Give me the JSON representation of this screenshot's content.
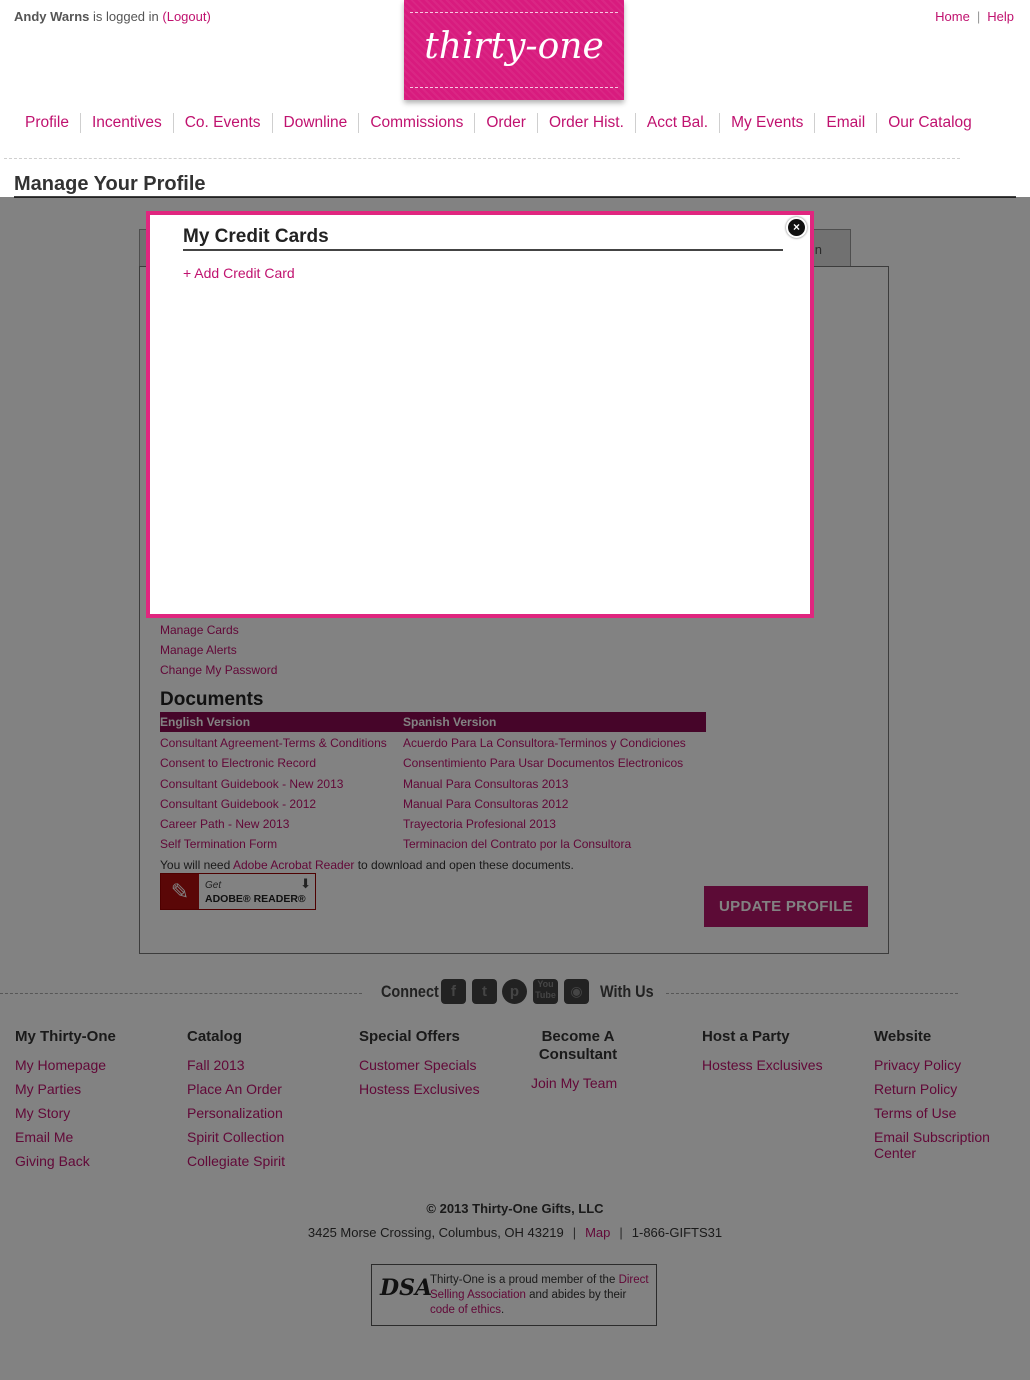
{
  "header": {
    "user_name": "Andy Warns",
    "logged_in_text": "is logged in",
    "logout_label": "(Logout)",
    "home_label": "Home",
    "help_label": "Help",
    "logo_text": "thirty-one"
  },
  "nav": [
    {
      "label": "Profile"
    },
    {
      "label": "Incentives"
    },
    {
      "label": "Co. Events"
    },
    {
      "label": "Downline"
    },
    {
      "label": "Commissions"
    },
    {
      "label": "Order"
    },
    {
      "label": "Order Hist."
    },
    {
      "label": "Acct Bal."
    },
    {
      "label": "My Events"
    },
    {
      "label": "Email"
    },
    {
      "label": "Our Catalog"
    }
  ],
  "page_title": "Manage Your Profile",
  "background_tab_fragment": "n",
  "account_links": [
    {
      "label": "Manage Cards"
    },
    {
      "label": "Manage Alerts"
    },
    {
      "label": "Change My Password"
    }
  ],
  "documents": {
    "title": "Documents",
    "english_header": "English Version",
    "spanish_header": "Spanish Version",
    "english": [
      {
        "label": "Consultant Agreement-Terms & Conditions"
      },
      {
        "label": "Consent to Electronic Record"
      },
      {
        "label": "Consultant Guidebook - New 2013"
      },
      {
        "label": "Consultant Guidebook - 2012"
      },
      {
        "label": "Career Path - New 2013"
      },
      {
        "label": "Self Termination Form"
      }
    ],
    "spanish": [
      {
        "label": "Acuerdo Para La Consultora-Terminos y Condiciones"
      },
      {
        "label": "Consentimiento Para Usar Documentos Electronicos"
      },
      {
        "label": "Manual Para Consultoras 2013"
      },
      {
        "label": "Manual Para Consultoras 2012"
      },
      {
        "label": "Trayectoria Profesional 2013"
      },
      {
        "label": "Terminacion del Contrato por la Consultora"
      }
    ],
    "acrobat_note_pre": "You will need",
    "acrobat_link": "Adobe Acrobat Reader",
    "acrobat_note_post": "to download and open these documents.",
    "reader_get": "Get",
    "reader_name": "ADOBE® READER®"
  },
  "update_button": "UPDATE PROFILE",
  "connect": {
    "connect_label": "Connect",
    "with_us_label": "With Us",
    "icons": [
      "facebook-icon",
      "twitter-icon",
      "pinterest-icon",
      "youtube-icon",
      "instagram-icon"
    ]
  },
  "footer_columns": [
    {
      "title": "My Thirty-One",
      "links": [
        "My Homepage",
        "My Parties",
        "My Story",
        "Email Me",
        "Giving Back"
      ]
    },
    {
      "title": "Catalog",
      "links": [
        "Fall 2013",
        "Place An Order",
        "Personalization",
        "Spirit Collection",
        "Collegiate Spirit"
      ]
    },
    {
      "title": "Special Offers",
      "links": [
        "Customer Specials",
        "Hostess Exclusives"
      ]
    },
    {
      "title": "Become A Consultant",
      "links": [
        "Join My Team"
      ]
    },
    {
      "title": "Host a Party",
      "links": [
        "Hostess Exclusives"
      ]
    },
    {
      "title": "Website",
      "links": [
        "Privacy Policy",
        "Return Policy",
        "Terms of Use",
        "Email Subscription Center"
      ]
    }
  ],
  "copyright": "© 2013 Thirty-One Gifts, LLC",
  "address": "3425 Morse Crossing, Columbus, OH 43219",
  "map_label": "Map",
  "phone": "1-866-GIFTS31",
  "dsa": {
    "logo": "DSA",
    "text_pre": "Thirty-One is a proud member of the",
    "link1": "Direct Selling Association",
    "text_mid": "and abides by their",
    "link2": "code of ethics",
    "text_post": "."
  },
  "modal": {
    "title": "My Credit Cards",
    "add_label": "+ Add Credit Card",
    "close_label": "×"
  },
  "colors": {
    "brand_pink": "#d81b7e",
    "link": "#c0126f",
    "modal_border": "#e0267f",
    "docs_header": "#8a0b52"
  }
}
